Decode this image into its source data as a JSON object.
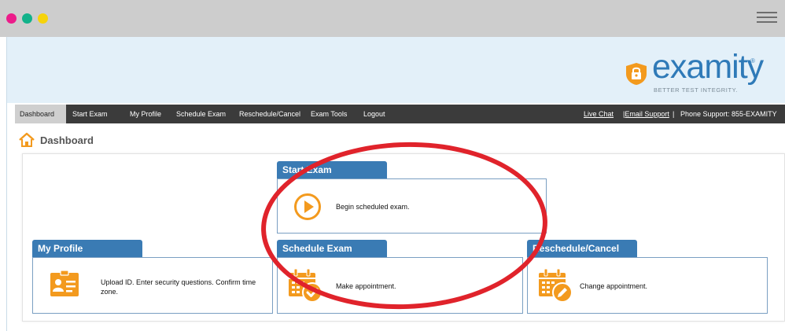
{
  "window": {
    "dot_colors": [
      "#ec1c8a",
      "#12b28a",
      "#f6d30b"
    ]
  },
  "logo": {
    "word": "examity",
    "reg": "®",
    "tagline": "BETTER TEST INTEGRITY."
  },
  "nav": {
    "items": [
      "Dashboard",
      "Start Exam",
      "My Profile",
      "Schedule Exam",
      "Reschedule/Cancel",
      "Exam Tools",
      "Logout"
    ],
    "live_chat": "Live Chat",
    "email_support": "|Email Support",
    "separator": "|",
    "phone_support": "Phone Support: 855-EXAMITY"
  },
  "page": {
    "title": "Dashboard"
  },
  "cards": {
    "start_exam": {
      "title": "Start Exam",
      "text": "Begin scheduled exam."
    },
    "my_profile": {
      "title": "My Profile",
      "text": "Upload ID. Enter security questions. Confirm time zone."
    },
    "schedule_exam": {
      "title": "Schedule Exam",
      "text": "Make appointment."
    },
    "reschedule": {
      "title": "Reschedule/Cancel",
      "text": "Change appointment."
    }
  },
  "colors": {
    "brand_blue": "#3a7bb4",
    "orange": "#f39a1e",
    "highlight_red": "#e0232b"
  },
  "icons": {
    "start_exam": "play-circle-icon",
    "my_profile": "id-card-icon",
    "schedule_exam": "calendar-check-icon",
    "reschedule": "calendar-edit-icon"
  }
}
